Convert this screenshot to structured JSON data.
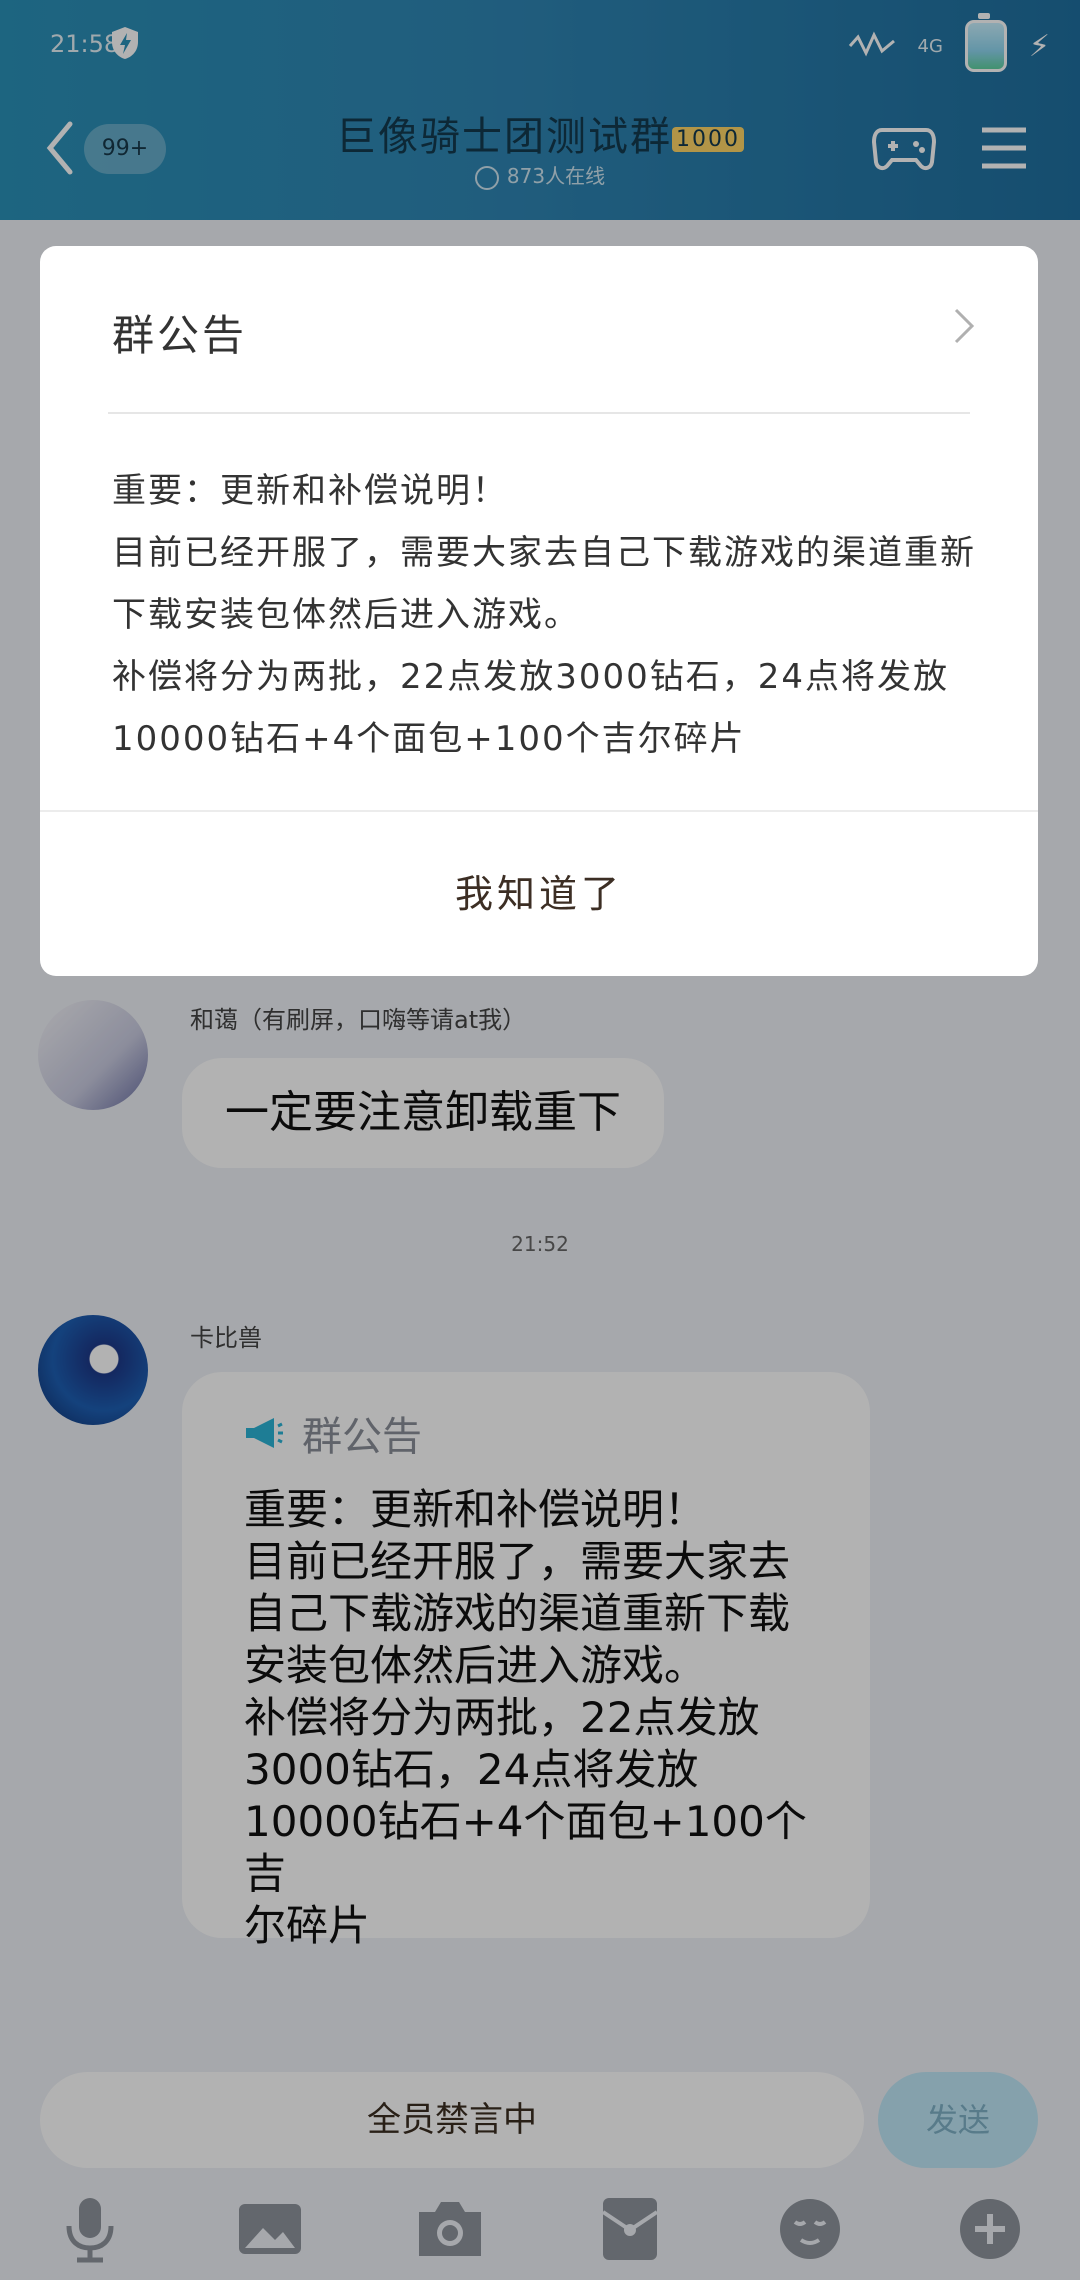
{
  "status_bar": {
    "time": "21:58",
    "network": "4G",
    "shield_icon": "shield-bolt-icon",
    "battery_icon": "battery-icon",
    "charging_icon": "lightning-icon"
  },
  "header": {
    "unread_badge": "99+",
    "group_title": "巨像骑士团测试群",
    "member_count": "1000",
    "online_status": "873人在线"
  },
  "dialog": {
    "title": "群公告",
    "body": "重要：更新和补偿说明！\n目前已经开服了，需要大家去自己下载游戏的渠道重新下载安装包体然后进入游戏。\n补偿将分为两批，22点发放3000钻石，24点将发放10000钻石+4个面包+100个吉尔碎片",
    "confirm_button": "我知道了"
  },
  "chat": {
    "messages": [
      {
        "sender": "和蔼（有刷屏，口嗨等请at我）",
        "text": "一定要注意卸载重下"
      },
      {
        "timestamp": "21:52",
        "sender": "卡比兽",
        "notice_label": "群公告",
        "notice_text": "重要：更新和补偿说明！\n目前已经开服了，需要大家去\n自己下载游戏的渠道重新下载\n安装包体然后进入游戏。\n补偿将分为两批，22点发放\n3000钻石，24点将发放\n10000钻石+4个面包+100个吉\n尔碎片"
      }
    ]
  },
  "input_bar": {
    "muted_text": "全员禁言中",
    "send_label": "发送"
  },
  "toolbar": [
    "microphone-icon",
    "image-icon",
    "camera-icon",
    "red-packet-icon",
    "emoji-icon",
    "plus-icon"
  ],
  "colors": {
    "header_gradient_start": "#2a91b8",
    "header_gradient_end": "#1f6f9f",
    "send_button": "#bfe7f7",
    "dialog_bg": "#ffffff"
  }
}
